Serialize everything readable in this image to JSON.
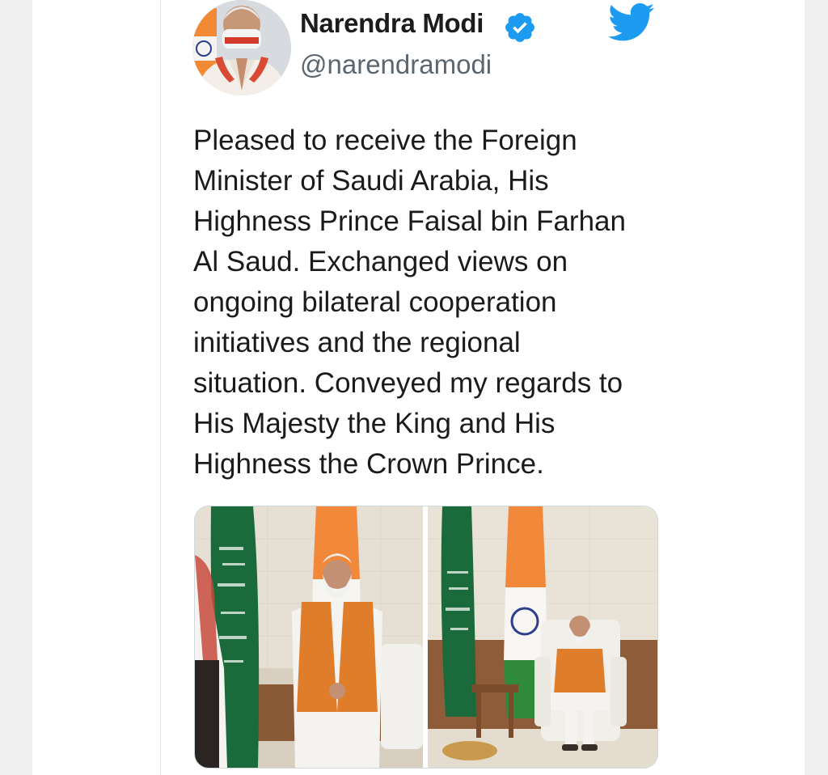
{
  "author": {
    "name": "Narendra Modi",
    "handle": "@narendramodi"
  },
  "tweet": {
    "text_lines": [
      "Pleased to receive the Foreign",
      "Minister of Saudi Arabia, His",
      "Highness Prince Faisal bin Farhan",
      "Al Saud. Exchanged views on",
      "ongoing bilateral cooperation",
      "initiatives and the regional",
      "situation. Conveyed my regards to",
      "His Majesty the King and His",
      "Highness the Crown Prince."
    ]
  },
  "icons": {
    "verified": "verified-badge-icon",
    "brand": "twitter-bird-icon"
  },
  "colors": {
    "brand_blue": "#1d9bf0",
    "name_text": "#1c1c1c",
    "handle_text": "#5b6670",
    "saffron": "#f2883a",
    "saudi_green": "#1a6a3c"
  }
}
